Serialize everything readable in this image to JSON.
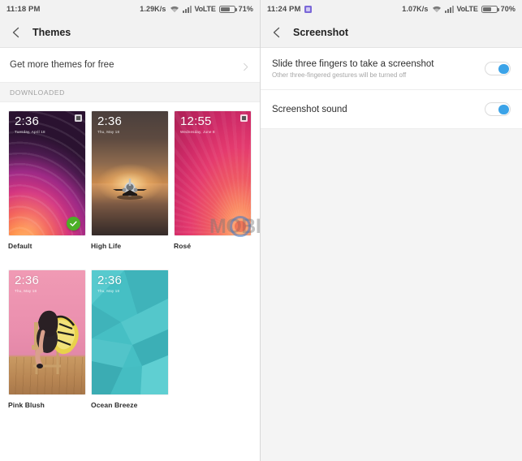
{
  "left_panel": {
    "status_bar": {
      "time": "11:18 PM",
      "network_speed": "1.29K/s",
      "wifi_icon": "wifi-icon",
      "signal_icon": "signal-bars-icon",
      "network_type": "VoLTE",
      "battery_icon": "battery-icon",
      "battery_percent": "71%"
    },
    "title_bar": {
      "back_icon": "back-chevron-icon",
      "title": "Themes"
    },
    "get_more": {
      "label": "Get more themes for free",
      "chevron_icon": "chevron-right-icon"
    },
    "section_header": "DOWNLOADED",
    "themes": [
      {
        "name": "Default",
        "time": "2:36",
        "date": "Tuesday, April 18",
        "applied": true,
        "has_delete": true,
        "art": "default-gradient"
      },
      {
        "name": "High Life",
        "time": "2:36",
        "date": "Thu, May 18",
        "applied": false,
        "has_delete": false,
        "art": "airplane-sunset"
      },
      {
        "name": "Rosé",
        "time": "12:55",
        "date": "Wednesday, June 8",
        "applied": false,
        "has_delete": true,
        "art": "rose-gradient"
      },
      {
        "name": "Pink Blush",
        "time": "2:36",
        "date": "Thu, May 18",
        "applied": false,
        "has_delete": false,
        "art": "pink-butterfly"
      },
      {
        "name": "Ocean Breeze",
        "time": "2:36",
        "date": "Thu, May 18",
        "applied": false,
        "has_delete": false,
        "art": "teal-polygons"
      }
    ]
  },
  "right_panel": {
    "status_bar": {
      "time": "11:24 PM",
      "app_icon": "app-notification-icon",
      "network_speed": "1.07K/s",
      "wifi_icon": "wifi-icon",
      "signal_icon": "signal-bars-icon",
      "network_type": "VoLTE",
      "battery_icon": "battery-icon",
      "battery_percent": "70%"
    },
    "title_bar": {
      "back_icon": "back-chevron-icon",
      "title": "Screenshot"
    },
    "settings": [
      {
        "title": "Slide three fingers to take a screenshot",
        "subtitle": "Other three-fingered gestures will be turned off",
        "toggle_on": true
      },
      {
        "title": "Screenshot sound",
        "subtitle": "",
        "toggle_on": true
      }
    ]
  },
  "watermark": {
    "text": "MOBIGYAAN",
    "logo_icon": "mobigyaan-logo-icon"
  },
  "colors": {
    "accent_toggle": "#3ba3e8",
    "applied_badge": "#4caf26",
    "panel_background": "#f4f4f4",
    "content_background": "#ffffff"
  }
}
